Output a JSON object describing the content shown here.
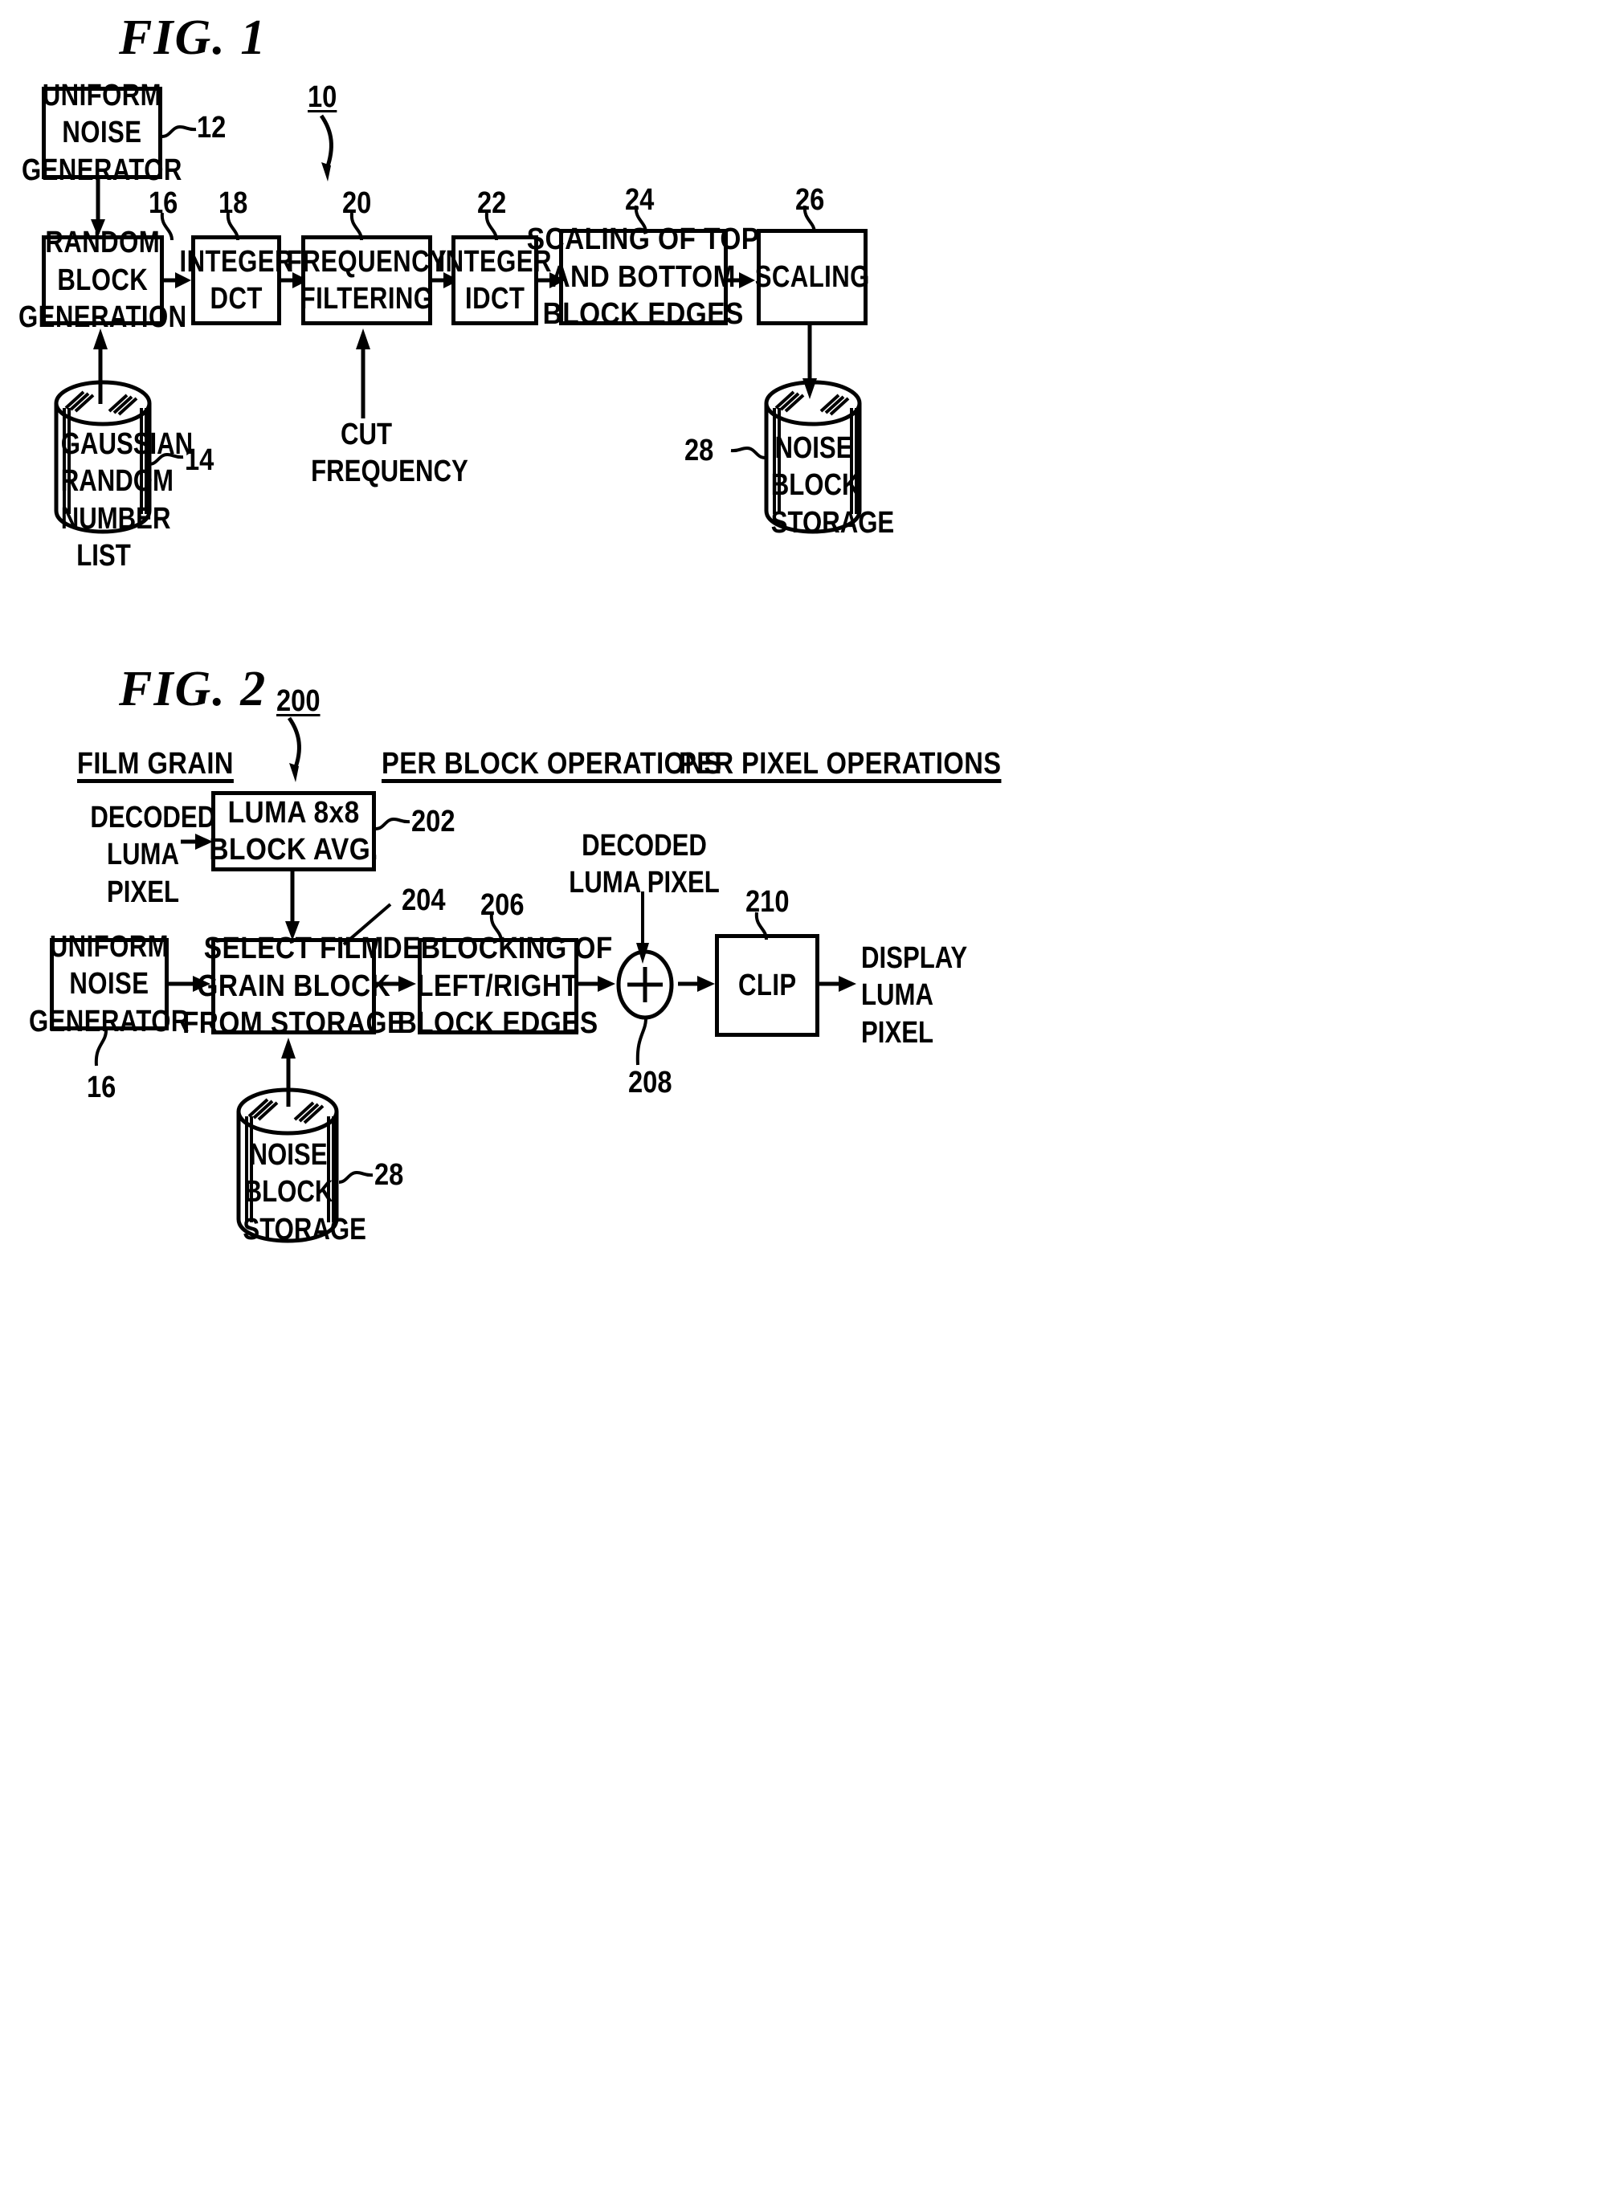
{
  "figure1": {
    "caption": "FIG. 1",
    "system_ref": "10",
    "blocks": [
      {
        "id": "uniform-noise-generator",
        "lines": [
          "UNIFORM",
          "NOISE",
          "GENERATOR"
        ],
        "ref": "12"
      },
      {
        "id": "random-block-generation",
        "lines": [
          "RANDOM",
          "BLOCK",
          "GENERATION"
        ],
        "ref": "16"
      },
      {
        "id": "integer-dct",
        "lines": [
          "INTEGER",
          "DCT"
        ],
        "ref": "18"
      },
      {
        "id": "frequency-filtering",
        "lines": [
          "FREQUENCY",
          "FILTERING"
        ],
        "ref": "20"
      },
      {
        "id": "integer-idct",
        "lines": [
          "INTEGER",
          "IDCT"
        ],
        "ref": "22"
      },
      {
        "id": "scaling-top-bottom",
        "lines": [
          "SCALING OF TOP",
          "AND BOTTOM",
          "BLOCK EDGES"
        ],
        "ref": "24"
      },
      {
        "id": "scaling",
        "lines": [
          "SCALING"
        ],
        "ref": "26"
      }
    ],
    "cylinders": [
      {
        "id": "gaussian-random-number-list",
        "lines": [
          "GAUSSIAN",
          "RANDOM",
          "NUMBER",
          "LIST"
        ],
        "ref": "14"
      },
      {
        "id": "noise-block-storage",
        "lines": [
          "NOISE",
          "BLOCK",
          "STORAGE"
        ],
        "ref": "28"
      }
    ],
    "input_labels": [
      {
        "id": "cut-frequency",
        "lines": [
          "CUT",
          "FREQUENCY"
        ]
      }
    ]
  },
  "figure2": {
    "caption": "FIG. 2",
    "system_ref": "200",
    "column_headers": [
      {
        "id": "film-grain",
        "text": "FILM GRAIN"
      },
      {
        "id": "per-block-operations",
        "text": "PER BLOCK OPERATIONS"
      },
      {
        "id": "per-pixel-operations",
        "text": "PER PIXEL OPERATIONS"
      }
    ],
    "blocks": [
      {
        "id": "luma-8x8-block-avg",
        "lines": [
          "LUMA 8x8",
          "BLOCK AVG."
        ],
        "ref": "202"
      },
      {
        "id": "uniform-noise-generator-2",
        "lines": [
          "UNIFORM",
          "NOISE",
          "GENERATOR"
        ],
        "ref": "16"
      },
      {
        "id": "select-film-grain-block",
        "lines": [
          "SELECT FILM",
          "GRAIN BLOCK",
          "FROM STORAGE"
        ],
        "ref": "204"
      },
      {
        "id": "deblocking-left-right",
        "lines": [
          "DEBLOCKING OF",
          "LEFT/RIGHT",
          "BLOCK EDGES"
        ],
        "ref": "206"
      },
      {
        "id": "clip",
        "lines": [
          "CLIP"
        ],
        "ref": "210"
      }
    ],
    "adder": {
      "id": "summing-junction",
      "symbol": "+",
      "ref": "208"
    },
    "cylinders": [
      {
        "id": "noise-block-storage-2",
        "lines": [
          "NOISE",
          "BLOCK",
          "STORAGE"
        ],
        "ref": "28"
      }
    ],
    "io_labels": [
      {
        "id": "decoded-luma-pixel-in",
        "lines": [
          "DECODED",
          "LUMA",
          "PIXEL"
        ]
      },
      {
        "id": "decoded-luma-pixel-adder",
        "lines": [
          "DECODED",
          "LUMA PIXEL"
        ]
      },
      {
        "id": "display-luma-pixel-out",
        "lines": [
          "DISPLAY",
          "LUMA",
          "PIXEL"
        ]
      }
    ]
  },
  "colors": {
    "ink": "#000000",
    "paper": "#ffffff"
  }
}
